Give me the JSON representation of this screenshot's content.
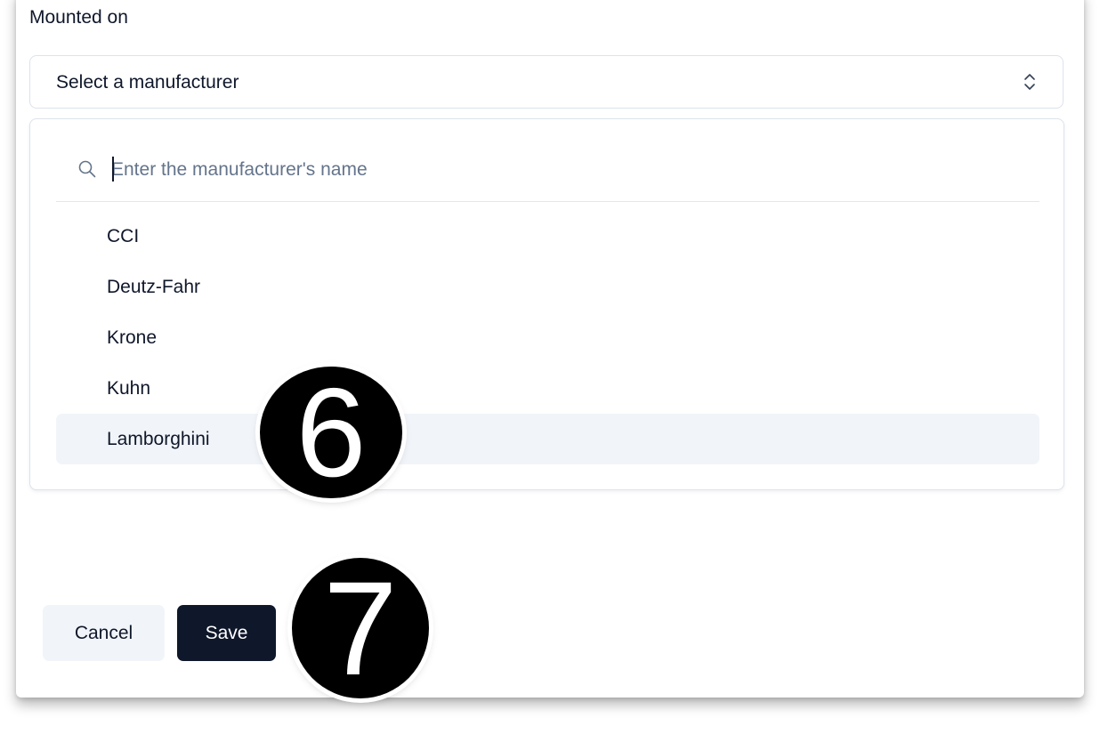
{
  "form": {
    "field_label": "Mounted on",
    "select": {
      "selected_text": "Select a manufacturer",
      "icon": "chevron-up-down-icon"
    },
    "dropdown": {
      "search": {
        "placeholder": "Enter the manufacturer's name",
        "value": "",
        "icon": "search-icon"
      },
      "options": [
        {
          "label": "CCI",
          "highlighted": false
        },
        {
          "label": "Deutz-Fahr",
          "highlighted": false
        },
        {
          "label": "Krone",
          "highlighted": false
        },
        {
          "label": "Kuhn",
          "highlighted": false
        },
        {
          "label": "Lamborghini",
          "highlighted": true
        }
      ]
    },
    "buttons": {
      "cancel_label": "Cancel",
      "save_label": "Save"
    }
  },
  "annotations": {
    "step_6": "6",
    "step_7": "7"
  },
  "colors": {
    "primary_button": "#0f172a",
    "secondary_button": "#f1f5f9",
    "highlight_row": "#f1f5f9",
    "border": "#dbe3ec",
    "placeholder": "#64748b",
    "badge": "#000000"
  }
}
